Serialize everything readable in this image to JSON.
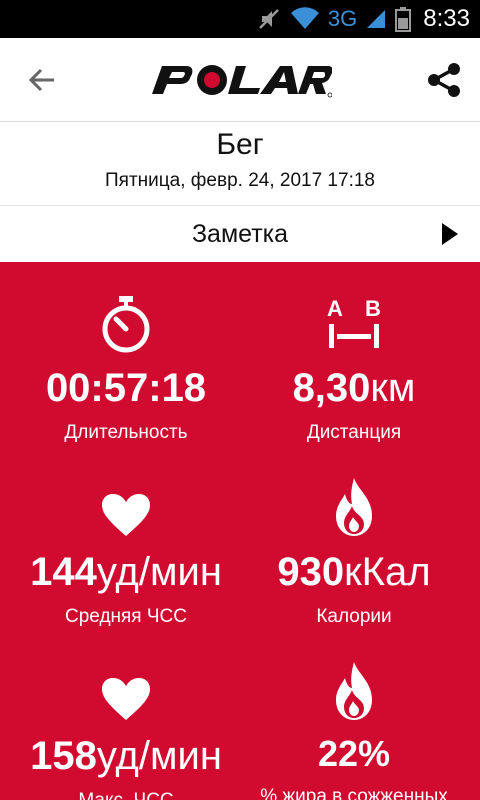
{
  "status_bar": {
    "network": "3G",
    "time": "8:33"
  },
  "app_bar": {
    "logo_text": "POLAR"
  },
  "header": {
    "title": "Бег",
    "subtitle": "Пятница, февр. 24, 2017 17:18"
  },
  "note": {
    "label": "Заметка"
  },
  "stats": [
    {
      "icon": "stopwatch-icon",
      "value": "00:57:18",
      "unit": "",
      "label": "Длительность"
    },
    {
      "icon": "distance-ab-icon",
      "value": "8,30",
      "unit": "км",
      "label": "Дистанция",
      "icon_text_a": "A",
      "icon_text_b": "B"
    },
    {
      "icon": "heart-icon",
      "value": "144",
      "unit": "уд/мин",
      "label": "Средняя ЧСС"
    },
    {
      "icon": "flame-icon",
      "value": "930",
      "unit": "кКал",
      "label": "Калории"
    },
    {
      "icon": "heart-icon",
      "value": "158",
      "unit": "уд/мин",
      "label": "Макс. ЧСС"
    },
    {
      "icon": "flame-icon",
      "value": "22%",
      "unit": "",
      "label": "% жира в сожженных"
    }
  ],
  "colors": {
    "accent": "#d10b2f",
    "status_bar": "#000000",
    "network_indicator": "#3b8fd6"
  }
}
